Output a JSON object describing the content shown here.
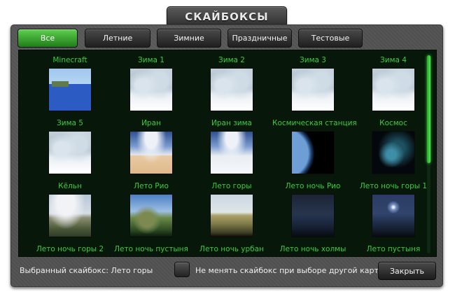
{
  "window": {
    "title": "СКАЙБОКСЫ"
  },
  "tabs": [
    {
      "label": "Все",
      "active": true
    },
    {
      "label": "Летние",
      "active": false
    },
    {
      "label": "Зимние",
      "active": false
    },
    {
      "label": "Праздничные",
      "active": false
    },
    {
      "label": "Тестовые",
      "active": false
    }
  ],
  "skyboxes": [
    {
      "label": "Minecraft",
      "thumb": "minecraft"
    },
    {
      "label": "Зима 1",
      "thumb": "winter"
    },
    {
      "label": "Зима 2",
      "thumb": "winter"
    },
    {
      "label": "Зима 3",
      "thumb": "winter"
    },
    {
      "label": "Зима 4",
      "thumb": "winter"
    },
    {
      "label": "Зима 5",
      "thumb": "winter"
    },
    {
      "label": "Иран",
      "thumb": "iran"
    },
    {
      "label": "Иран зима",
      "thumb": "iranw"
    },
    {
      "label": "Космическая станция",
      "thumb": "station"
    },
    {
      "label": "Космос",
      "thumb": "space"
    },
    {
      "label": "Кёльн",
      "thumb": "koln"
    },
    {
      "label": "Лето Рио",
      "thumb": "rio"
    },
    {
      "label": "Лето горы",
      "thumb": "mount"
    },
    {
      "label": "Лето ночь Рио",
      "thumb": "nrio"
    },
    {
      "label": "Лето ночь горы 1",
      "thumb": "nmount"
    },
    {
      "label": "Лето ночь горы 2",
      "thumb": "nmount"
    },
    {
      "label": "Лето ночь пустыня",
      "thumb": "nrio"
    },
    {
      "label": "Лето ночь урбан",
      "thumb": "nrio"
    },
    {
      "label": "Лето ночь холмы",
      "thumb": "nrio"
    },
    {
      "label": "Лето пустыня",
      "thumb": "iran"
    }
  ],
  "footer": {
    "selected_text": "Выбранный скайбокс: Лето горы",
    "checkbox_label": "Не менять скайбокс при выборе другой карты",
    "checkbox_checked": false,
    "close_label": "Закрыть"
  },
  "colors": {
    "accent_green": "#35d03a",
    "panel_bg": "#07170a"
  }
}
